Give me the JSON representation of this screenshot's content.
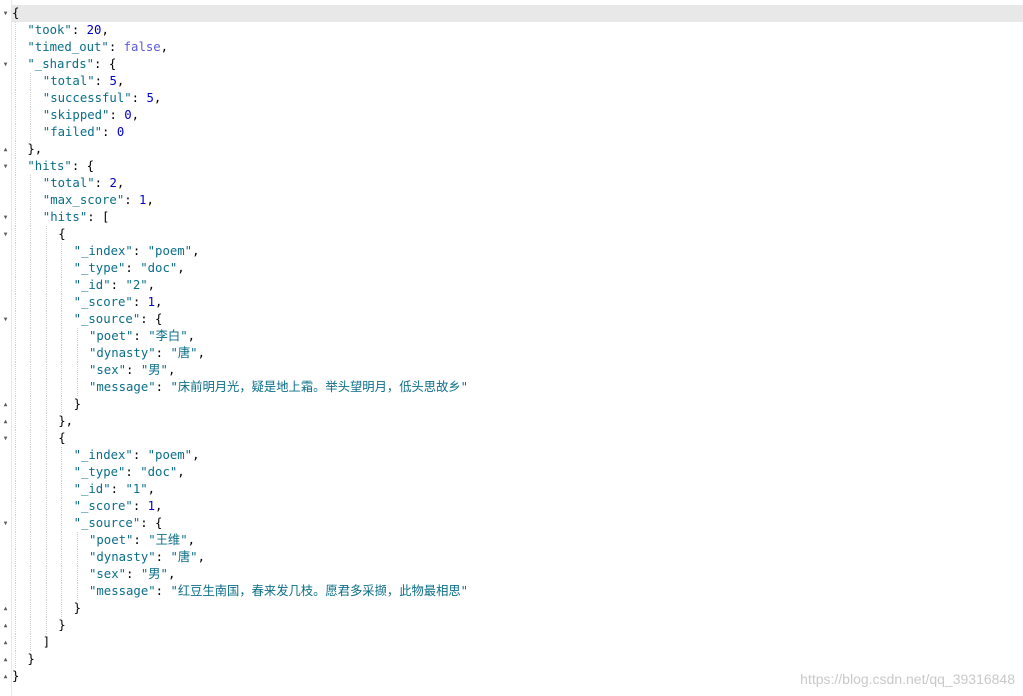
{
  "json_lines": [
    {
      "indent": 0,
      "fold": "open",
      "parts": [
        {
          "t": "p",
          "v": "{"
        }
      ]
    },
    {
      "indent": 1,
      "fold": "",
      "parts": [
        {
          "t": "k",
          "v": "\"took\""
        },
        {
          "t": "p",
          "v": ": "
        },
        {
          "t": "n",
          "v": "20"
        },
        {
          "t": "p",
          "v": ","
        }
      ]
    },
    {
      "indent": 1,
      "fold": "",
      "parts": [
        {
          "t": "k",
          "v": "\"timed_out\""
        },
        {
          "t": "p",
          "v": ": "
        },
        {
          "t": "b",
          "v": "false"
        },
        {
          "t": "p",
          "v": ","
        }
      ]
    },
    {
      "indent": 1,
      "fold": "open",
      "parts": [
        {
          "t": "k",
          "v": "\"_shards\""
        },
        {
          "t": "p",
          "v": ": {"
        }
      ]
    },
    {
      "indent": 2,
      "fold": "",
      "parts": [
        {
          "t": "k",
          "v": "\"total\""
        },
        {
          "t": "p",
          "v": ": "
        },
        {
          "t": "n",
          "v": "5"
        },
        {
          "t": "p",
          "v": ","
        }
      ]
    },
    {
      "indent": 2,
      "fold": "",
      "parts": [
        {
          "t": "k",
          "v": "\"successful\""
        },
        {
          "t": "p",
          "v": ": "
        },
        {
          "t": "n",
          "v": "5"
        },
        {
          "t": "p",
          "v": ","
        }
      ]
    },
    {
      "indent": 2,
      "fold": "",
      "parts": [
        {
          "t": "k",
          "v": "\"skipped\""
        },
        {
          "t": "p",
          "v": ": "
        },
        {
          "t": "n",
          "v": "0"
        },
        {
          "t": "p",
          "v": ","
        }
      ]
    },
    {
      "indent": 2,
      "fold": "",
      "parts": [
        {
          "t": "k",
          "v": "\"failed\""
        },
        {
          "t": "p",
          "v": ": "
        },
        {
          "t": "n",
          "v": "0"
        }
      ]
    },
    {
      "indent": 1,
      "fold": "close",
      "parts": [
        {
          "t": "p",
          "v": "},"
        }
      ]
    },
    {
      "indent": 1,
      "fold": "open",
      "parts": [
        {
          "t": "k",
          "v": "\"hits\""
        },
        {
          "t": "p",
          "v": ": {"
        }
      ]
    },
    {
      "indent": 2,
      "fold": "",
      "parts": [
        {
          "t": "k",
          "v": "\"total\""
        },
        {
          "t": "p",
          "v": ": "
        },
        {
          "t": "n",
          "v": "2"
        },
        {
          "t": "p",
          "v": ","
        }
      ]
    },
    {
      "indent": 2,
      "fold": "",
      "parts": [
        {
          "t": "k",
          "v": "\"max_score\""
        },
        {
          "t": "p",
          "v": ": "
        },
        {
          "t": "n",
          "v": "1"
        },
        {
          "t": "p",
          "v": ","
        }
      ]
    },
    {
      "indent": 2,
      "fold": "open",
      "parts": [
        {
          "t": "k",
          "v": "\"hits\""
        },
        {
          "t": "p",
          "v": ": ["
        }
      ]
    },
    {
      "indent": 3,
      "fold": "open",
      "parts": [
        {
          "t": "p",
          "v": "{"
        }
      ]
    },
    {
      "indent": 4,
      "fold": "",
      "parts": [
        {
          "t": "k",
          "v": "\"_index\""
        },
        {
          "t": "p",
          "v": ": "
        },
        {
          "t": "s",
          "v": "\"poem\""
        },
        {
          "t": "p",
          "v": ","
        }
      ]
    },
    {
      "indent": 4,
      "fold": "",
      "parts": [
        {
          "t": "k",
          "v": "\"_type\""
        },
        {
          "t": "p",
          "v": ": "
        },
        {
          "t": "s",
          "v": "\"doc\""
        },
        {
          "t": "p",
          "v": ","
        }
      ]
    },
    {
      "indent": 4,
      "fold": "",
      "parts": [
        {
          "t": "k",
          "v": "\"_id\""
        },
        {
          "t": "p",
          "v": ": "
        },
        {
          "t": "s",
          "v": "\"2\""
        },
        {
          "t": "p",
          "v": ","
        }
      ]
    },
    {
      "indent": 4,
      "fold": "",
      "parts": [
        {
          "t": "k",
          "v": "\"_score\""
        },
        {
          "t": "p",
          "v": ": "
        },
        {
          "t": "n",
          "v": "1"
        },
        {
          "t": "p",
          "v": ","
        }
      ]
    },
    {
      "indent": 4,
      "fold": "open",
      "parts": [
        {
          "t": "k",
          "v": "\"_source\""
        },
        {
          "t": "p",
          "v": ": {"
        }
      ]
    },
    {
      "indent": 5,
      "fold": "",
      "parts": [
        {
          "t": "k",
          "v": "\"poet\""
        },
        {
          "t": "p",
          "v": ": "
        },
        {
          "t": "s",
          "v": "\"李白\""
        },
        {
          "t": "p",
          "v": ","
        }
      ]
    },
    {
      "indent": 5,
      "fold": "",
      "parts": [
        {
          "t": "k",
          "v": "\"dynasty\""
        },
        {
          "t": "p",
          "v": ": "
        },
        {
          "t": "s",
          "v": "\"唐\""
        },
        {
          "t": "p",
          "v": ","
        }
      ]
    },
    {
      "indent": 5,
      "fold": "",
      "parts": [
        {
          "t": "k",
          "v": "\"sex\""
        },
        {
          "t": "p",
          "v": ": "
        },
        {
          "t": "s",
          "v": "\"男\""
        },
        {
          "t": "p",
          "v": ","
        }
      ]
    },
    {
      "indent": 5,
      "fold": "",
      "parts": [
        {
          "t": "k",
          "v": "\"message\""
        },
        {
          "t": "p",
          "v": ": "
        },
        {
          "t": "s",
          "v": "\"床前明月光，疑是地上霜。举头望明月，低头思故乡\""
        }
      ]
    },
    {
      "indent": 4,
      "fold": "close",
      "parts": [
        {
          "t": "p",
          "v": "}"
        }
      ]
    },
    {
      "indent": 3,
      "fold": "close",
      "parts": [
        {
          "t": "p",
          "v": "},"
        }
      ]
    },
    {
      "indent": 3,
      "fold": "open",
      "parts": [
        {
          "t": "p",
          "v": "{"
        }
      ]
    },
    {
      "indent": 4,
      "fold": "",
      "parts": [
        {
          "t": "k",
          "v": "\"_index\""
        },
        {
          "t": "p",
          "v": ": "
        },
        {
          "t": "s",
          "v": "\"poem\""
        },
        {
          "t": "p",
          "v": ","
        }
      ]
    },
    {
      "indent": 4,
      "fold": "",
      "parts": [
        {
          "t": "k",
          "v": "\"_type\""
        },
        {
          "t": "p",
          "v": ": "
        },
        {
          "t": "s",
          "v": "\"doc\""
        },
        {
          "t": "p",
          "v": ","
        }
      ]
    },
    {
      "indent": 4,
      "fold": "",
      "parts": [
        {
          "t": "k",
          "v": "\"_id\""
        },
        {
          "t": "p",
          "v": ": "
        },
        {
          "t": "s",
          "v": "\"1\""
        },
        {
          "t": "p",
          "v": ","
        }
      ]
    },
    {
      "indent": 4,
      "fold": "",
      "parts": [
        {
          "t": "k",
          "v": "\"_score\""
        },
        {
          "t": "p",
          "v": ": "
        },
        {
          "t": "n",
          "v": "1"
        },
        {
          "t": "p",
          "v": ","
        }
      ]
    },
    {
      "indent": 4,
      "fold": "open",
      "parts": [
        {
          "t": "k",
          "v": "\"_source\""
        },
        {
          "t": "p",
          "v": ": {"
        }
      ]
    },
    {
      "indent": 5,
      "fold": "",
      "parts": [
        {
          "t": "k",
          "v": "\"poet\""
        },
        {
          "t": "p",
          "v": ": "
        },
        {
          "t": "s",
          "v": "\"王维\""
        },
        {
          "t": "p",
          "v": ","
        }
      ]
    },
    {
      "indent": 5,
      "fold": "",
      "parts": [
        {
          "t": "k",
          "v": "\"dynasty\""
        },
        {
          "t": "p",
          "v": ": "
        },
        {
          "t": "s",
          "v": "\"唐\""
        },
        {
          "t": "p",
          "v": ","
        }
      ]
    },
    {
      "indent": 5,
      "fold": "",
      "parts": [
        {
          "t": "k",
          "v": "\"sex\""
        },
        {
          "t": "p",
          "v": ": "
        },
        {
          "t": "s",
          "v": "\"男\""
        },
        {
          "t": "p",
          "v": ","
        }
      ]
    },
    {
      "indent": 5,
      "fold": "",
      "parts": [
        {
          "t": "k",
          "v": "\"message\""
        },
        {
          "t": "p",
          "v": ": "
        },
        {
          "t": "s",
          "v": "\"红豆生南国，春来发几枝。愿君多采撷，此物最相思\""
        }
      ]
    },
    {
      "indent": 4,
      "fold": "close",
      "parts": [
        {
          "t": "p",
          "v": "}"
        }
      ]
    },
    {
      "indent": 3,
      "fold": "close",
      "parts": [
        {
          "t": "p",
          "v": "}"
        }
      ]
    },
    {
      "indent": 2,
      "fold": "close",
      "parts": [
        {
          "t": "p",
          "v": "]"
        }
      ]
    },
    {
      "indent": 1,
      "fold": "close",
      "parts": [
        {
          "t": "p",
          "v": "}"
        }
      ]
    },
    {
      "indent": 0,
      "fold": "close",
      "parts": [
        {
          "t": "p",
          "v": "}"
        }
      ]
    }
  ],
  "watermark": "https://blog.csdn.net/qq_39316848",
  "colors": {
    "key": "#0b6e88",
    "string": "#0b6e88",
    "number": "#0000cd",
    "boolean": "#5b5bd6",
    "punctuation": "#000000",
    "active_line": "#e8e8e8"
  },
  "icons": {
    "fold_open": "fold-open-icon",
    "fold_close": "fold-close-icon"
  }
}
